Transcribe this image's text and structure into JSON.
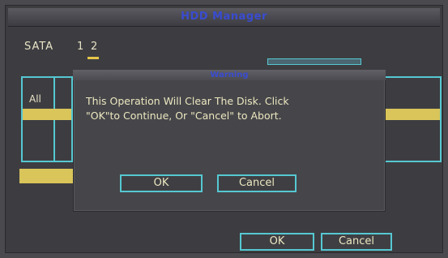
{
  "window": {
    "title": "HDD Manager"
  },
  "sata": {
    "label": "SATA",
    "tabs": [
      "1",
      "2"
    ],
    "selected_index": 1
  },
  "list": {
    "all_label": "All"
  },
  "dialog": {
    "title": "Warning",
    "message_line1": "This Operation Will Clear The Disk. Click",
    "message_line2": "\"OK\"to Continue, Or \"Cancel\" to Abort.",
    "ok_label": "OK",
    "cancel_label": "Cancel"
  },
  "footer": {
    "ok_label": "OK",
    "cancel_label": "Cancel"
  },
  "colors": {
    "accent_cyan": "#55c8d2",
    "highlight_yellow": "#d9c55a",
    "title_blue": "#3a4cd0"
  }
}
